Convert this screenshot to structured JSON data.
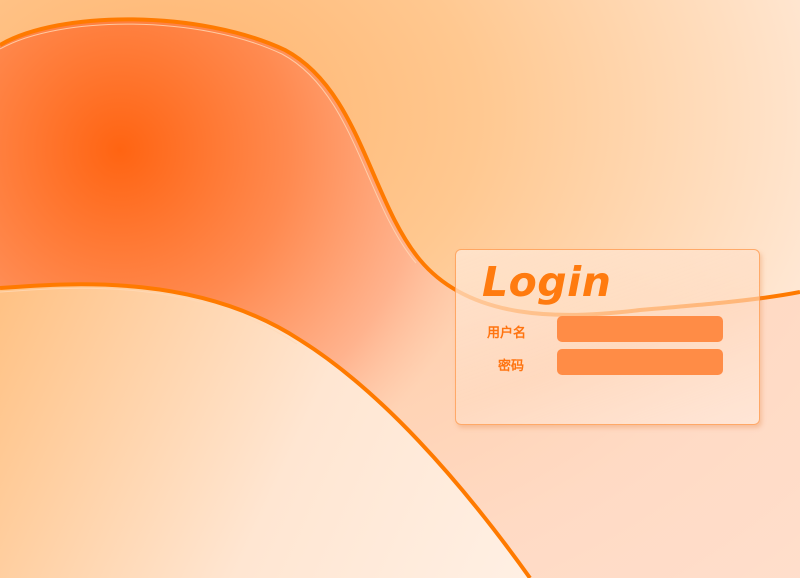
{
  "login": {
    "title": "Login",
    "username_label": "用户名",
    "username_value": "",
    "password_label": "密码",
    "password_value": ""
  },
  "colors": {
    "accent": "#ff7b0f",
    "input_fill": "#ff8c46",
    "wave_stroke": "#ff7a00",
    "wave_fill": "#ff6a1a"
  }
}
